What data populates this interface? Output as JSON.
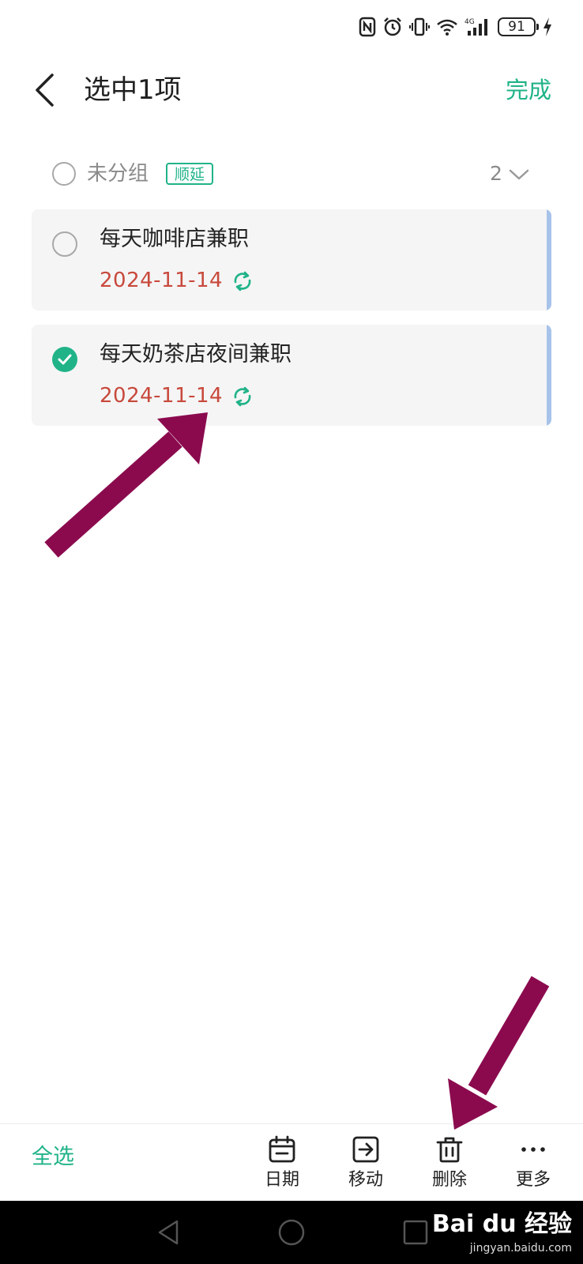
{
  "status_bar": {
    "battery_level": "91"
  },
  "header": {
    "title": "选中1项",
    "done_label": "完成"
  },
  "group": {
    "name": "未分组",
    "tag": "顺延",
    "count": "2"
  },
  "tasks": [
    {
      "title": "每天咖啡店兼职",
      "date": "2024-11-14",
      "checked": false,
      "repeat_icon": "repeat-icon"
    },
    {
      "title": "每天奶茶店夜间兼职",
      "date": "2024-11-14",
      "checked": true,
      "repeat_icon": "repeat-icon"
    }
  ],
  "toolbar": {
    "select_all": "全选",
    "actions": [
      {
        "label": "日期",
        "icon": "calendar-icon"
      },
      {
        "label": "移动",
        "icon": "move-icon"
      },
      {
        "label": "删除",
        "icon": "trash-icon"
      },
      {
        "label": "更多",
        "icon": "more-icon"
      }
    ]
  },
  "watermark": {
    "brand": "Bai du 经验",
    "url": "jingyan.baidu.com"
  },
  "colors": {
    "accent": "#20b388",
    "date_overdue": "#c8493c",
    "card_bg": "#f5f5f5",
    "card_stripe": "#a7c3ea",
    "annotation_arrow": "#8b0a4e"
  }
}
